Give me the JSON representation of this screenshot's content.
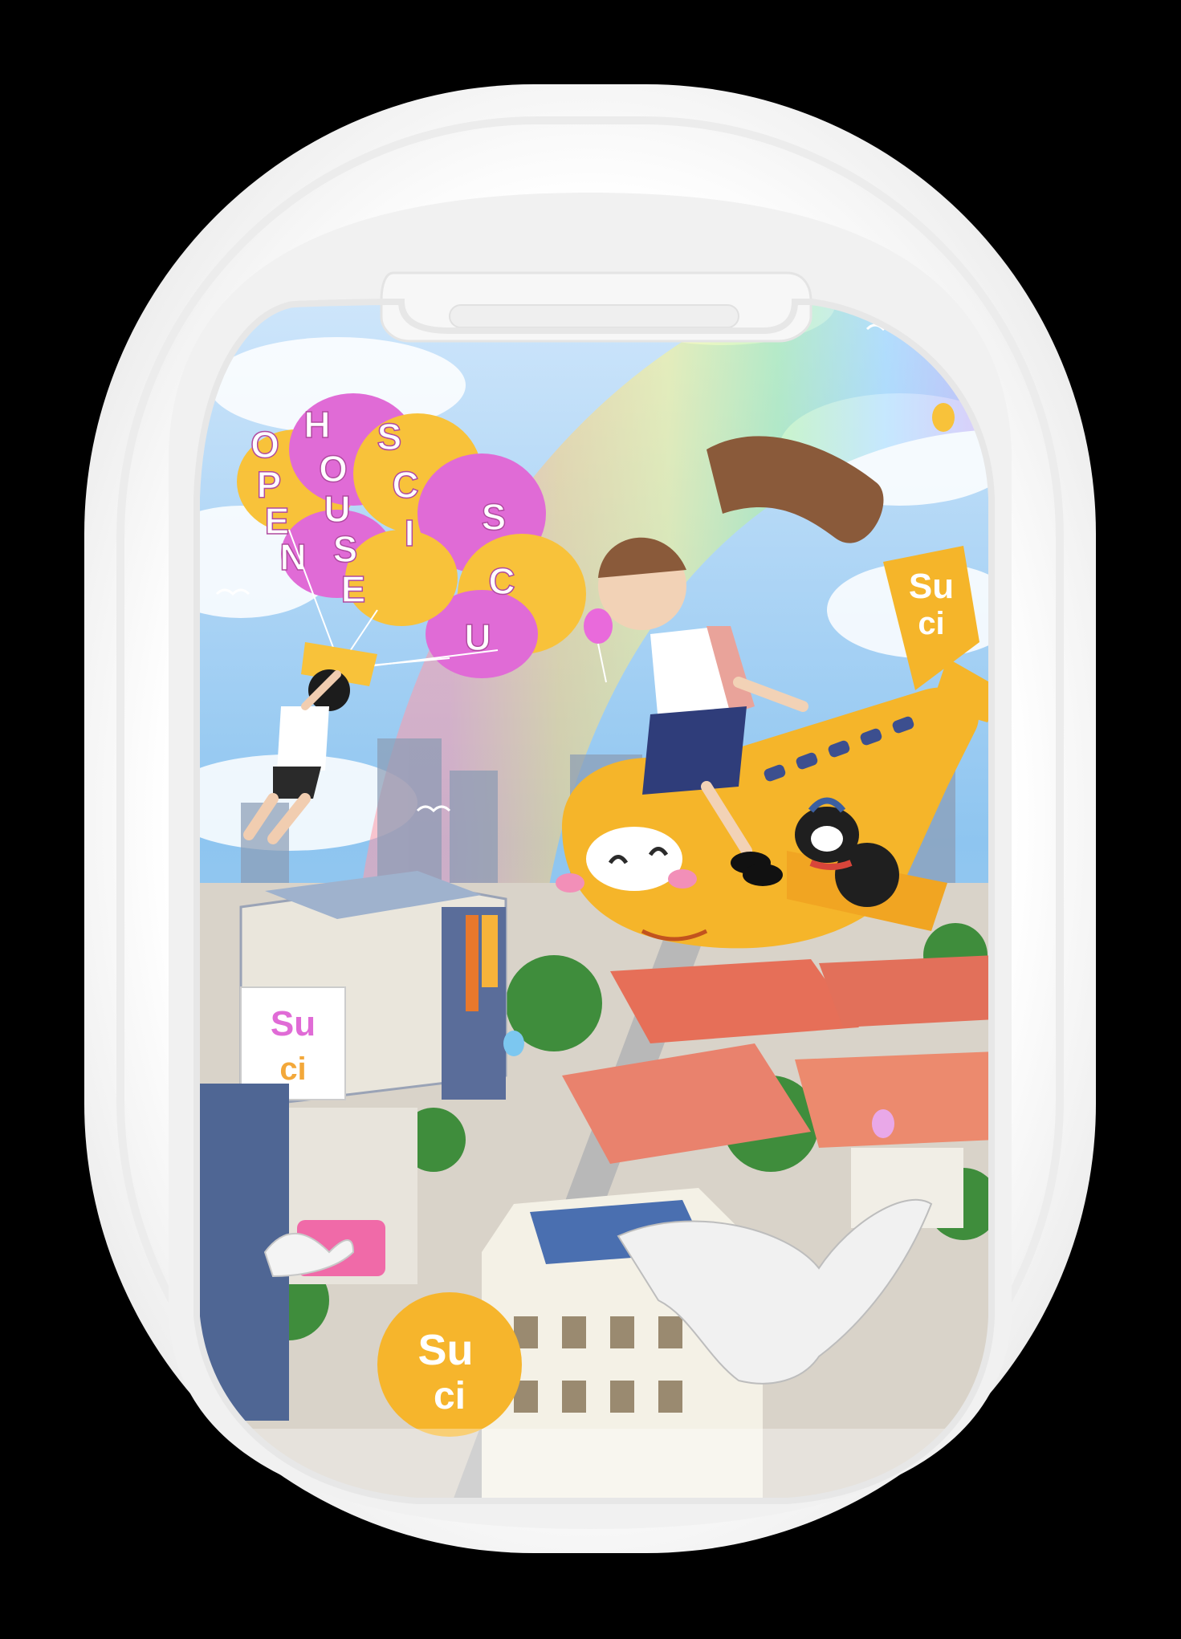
{
  "colors": {
    "background": "#000000",
    "frame": "#f6f6f6",
    "plane": "#f5b52a",
    "balloon_pink": "#e06bd6",
    "balloon_yellow": "#f8c23a",
    "sky": "#8ec5f0"
  },
  "balloon": {
    "lettering": [
      "O",
      "P",
      "E",
      "N",
      "H",
      "O",
      "U",
      "S",
      "E",
      "S",
      "C",
      "I",
      "S",
      "C",
      "U"
    ]
  },
  "plane": {
    "logo_top": "Su",
    "logo_bottom": "ci"
  },
  "building_banner": {
    "logo_top": "Su",
    "logo_bottom": "ci"
  },
  "badge": {
    "logo_top": "Su",
    "logo_bottom": "ci"
  },
  "icons": {
    "window": "airplane-window-icon",
    "plane": "cartoon-plane-icon",
    "dove": "dove-icon",
    "balloon": "party-balloon-icon"
  }
}
